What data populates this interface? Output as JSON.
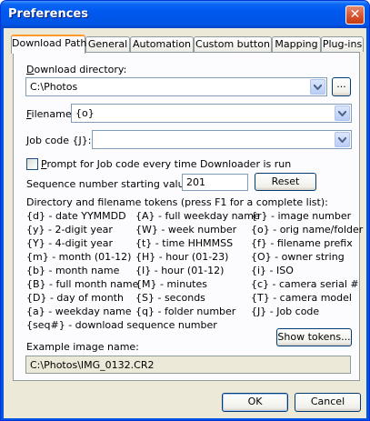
{
  "window": {
    "title": "Preferences"
  },
  "tabs": [
    "Download Path",
    "General",
    "Automation",
    "Custom button",
    "Mapping",
    "Plug-ins"
  ],
  "download_directory": {
    "label_prefix": "D",
    "label_rest": "ownload directory:",
    "value": "C:\\Photos",
    "browse_label": "..."
  },
  "filename": {
    "label_prefix": "F",
    "label_rest": "ilename:",
    "value": "{o}"
  },
  "job_code": {
    "label_prefix": "J",
    "label_rest": "ob code {J}:",
    "value": ""
  },
  "prompt_job_code": {
    "label_prefix": "P",
    "label_rest": "rompt for Job code every time Downloader is run",
    "checked": false
  },
  "sequence": {
    "label": "Sequence number starting value:",
    "value": "201",
    "reset_label": "Reset"
  },
  "tokens": {
    "heading": "Directory and filename tokens (press F1 for a complete list):",
    "col1": [
      "{d} - date YYMMDD",
      "{y} - 2-digit year",
      "{Y} - 4-digit year",
      "{m} - month (01-12)",
      "{b} - month name",
      "{B} - full month name",
      "{D} - day of month",
      "{a} - weekday name"
    ],
    "col2": [
      "{A} - full weekday name",
      "{W} - week number",
      "{t} - time HHMMSS",
      "{H} - hour (01-23)",
      "{I} - hour (01-12)",
      "{M} - minutes",
      "{S} - seconds",
      "{q} - folder number"
    ],
    "col3": [
      "{r} - image number",
      "{o} - orig name/folder",
      "{f} - filename prefix",
      "{O} - owner string",
      "{i} - ISO",
      "{c} - camera serial #",
      "{T} - camera model",
      "{J} - Job code"
    ],
    "last": "{seq#} - download sequence number",
    "show_label": "Show tokens..."
  },
  "example": {
    "label": "Example image name:",
    "value": "C:\\Photos\\IMG_0132.CR2"
  },
  "footer": {
    "ok_label": "OK",
    "cancel_label": "Cancel"
  }
}
